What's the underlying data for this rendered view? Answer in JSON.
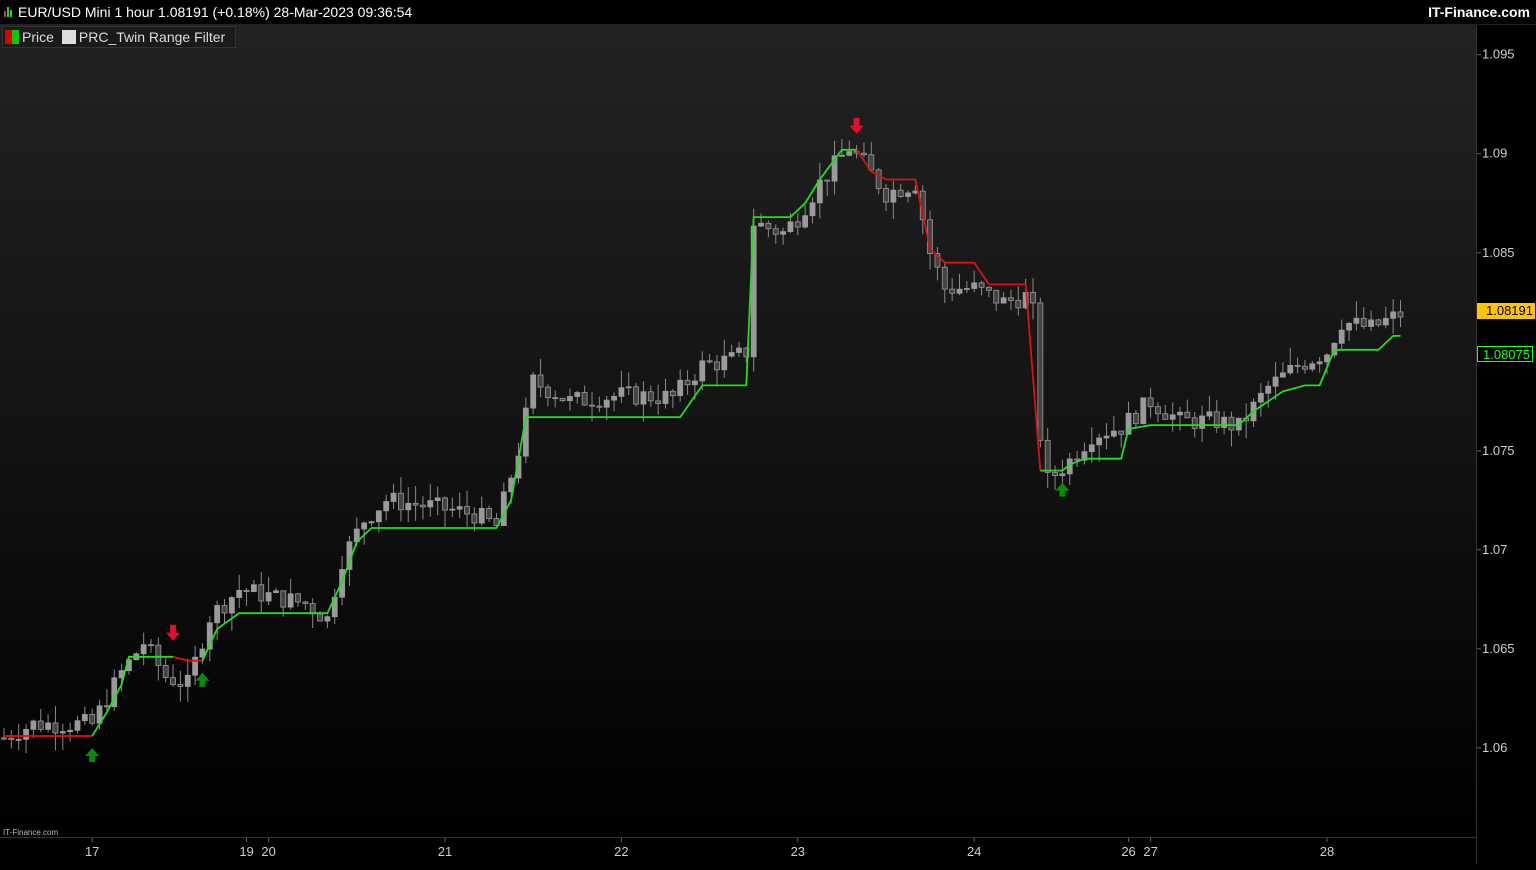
{
  "title_bar": {
    "title": "EUR/USD Mini 1 hour 1.08191 (+0.18%) 28-Mar-2023 09:36:54",
    "brand": "IT-Finance.com"
  },
  "legend": {
    "items": [
      {
        "label": "Price"
      },
      {
        "label": "PRC_Twin Range Filter"
      }
    ]
  },
  "watermark": "IT-Finance.com",
  "price_labels": {
    "last": "1.08191",
    "filter": "1.08075"
  },
  "colors": {
    "up_filter": "#22dd22",
    "down_filter": "#dd1111",
    "last_price_bg": "#ffc400",
    "buy_arrow": "#0a8a0a",
    "sell_arrow": "#e0102f",
    "candle": "#8a8a8a"
  },
  "chart_data": {
    "type": "line",
    "ylim": [
      1.0555,
      1.0965
    ],
    "y_ticks": [
      "1.06",
      "1.065",
      "1.07",
      "1.075",
      "1.08",
      "1.085",
      "1.09",
      "1.095"
    ],
    "x_ticks": [
      "17",
      "19",
      "20",
      "21",
      "22",
      "23",
      "24",
      "26",
      "27",
      "28"
    ],
    "bar_count": 200,
    "x_tick_bars": [
      12,
      33,
      36,
      60,
      84,
      108,
      132,
      153,
      156,
      180
    ],
    "series": [
      {
        "name": "PRC_Twin Range Filter",
        "points": [
          [
            0,
            1.0606
          ],
          [
            12,
            1.0606
          ],
          [
            14,
            1.0618
          ],
          [
            16,
            1.0632
          ],
          [
            17,
            1.0646
          ],
          [
            23,
            1.0646
          ],
          [
            25,
            1.0644
          ],
          [
            27,
            1.0644
          ],
          [
            29,
            1.066
          ],
          [
            32,
            1.0668
          ],
          [
            44,
            1.0668
          ],
          [
            46,
            1.0684
          ],
          [
            48,
            1.0704
          ],
          [
            50,
            1.0711
          ],
          [
            67,
            1.0711
          ],
          [
            69,
            1.0725
          ],
          [
            71,
            1.0767
          ],
          [
            92,
            1.0767
          ],
          [
            95,
            1.0783
          ],
          [
            101,
            1.0783
          ],
          [
            102,
            1.0868
          ],
          [
            107,
            1.0868
          ],
          [
            109,
            1.0875
          ],
          [
            111,
            1.0887
          ],
          [
            114,
            1.0902
          ],
          [
            116,
            1.0902
          ],
          [
            118,
            1.0891
          ],
          [
            120,
            1.0887
          ],
          [
            124,
            1.0887
          ],
          [
            126,
            1.0852
          ],
          [
            128,
            1.0845
          ],
          [
            132,
            1.0845
          ],
          [
            134,
            1.0834
          ],
          [
            139,
            1.0834
          ],
          [
            141,
            1.074
          ],
          [
            144,
            1.074
          ],
          [
            145,
            1.0743
          ],
          [
            147,
            1.0746
          ],
          [
            152,
            1.0746
          ],
          [
            153,
            1.0761
          ],
          [
            156,
            1.0763
          ],
          [
            168,
            1.0763
          ],
          [
            170,
            1.077
          ],
          [
            174,
            1.078
          ],
          [
            177,
            1.0783
          ],
          [
            179,
            1.0783
          ],
          [
            181,
            1.0801
          ],
          [
            187,
            1.0801
          ],
          [
            189,
            1.0808
          ],
          [
            190,
            1.0808
          ]
        ],
        "color_segments": [
          {
            "from": 0,
            "to": 12,
            "color": "down"
          },
          {
            "from": 12,
            "to": 23,
            "color": "up"
          },
          {
            "from": 23,
            "to": 27,
            "color": "down"
          },
          {
            "from": 27,
            "to": 116,
            "color": "up"
          },
          {
            "from": 116,
            "to": 141,
            "color": "down"
          },
          {
            "from": 141,
            "to": 190,
            "color": "up"
          }
        ]
      },
      {
        "name": "Price",
        "type": "candlestick",
        "anchors": [
          [
            0,
            1.0605
          ],
          [
            4,
            1.0612
          ],
          [
            8,
            1.0612
          ],
          [
            12,
            1.0612
          ],
          [
            16,
            1.0638
          ],
          [
            19,
            1.0653
          ],
          [
            22,
            1.0636
          ],
          [
            25,
            1.0632
          ],
          [
            28,
            1.0666
          ],
          [
            32,
            1.068
          ],
          [
            37,
            1.0676
          ],
          [
            41,
            1.0673
          ],
          [
            44,
            1.0665
          ],
          [
            46,
            1.0695
          ],
          [
            49,
            1.0715
          ],
          [
            52,
            1.0725
          ],
          [
            58,
            1.0722
          ],
          [
            64,
            1.0718
          ],
          [
            67,
            1.0712
          ],
          [
            70,
            1.075
          ],
          [
            72,
            1.0785
          ],
          [
            77,
            1.0775
          ],
          [
            84,
            1.0778
          ],
          [
            91,
            1.0777
          ],
          [
            95,
            1.0793
          ],
          [
            99,
            1.0796
          ],
          [
            101,
            1.08
          ],
          [
            102,
            1.0865
          ],
          [
            106,
            1.086
          ],
          [
            108,
            1.0868
          ],
          [
            111,
            1.0885
          ],
          [
            115,
            1.0903
          ],
          [
            117,
            1.0895
          ],
          [
            120,
            1.088
          ],
          [
            124,
            1.0885
          ],
          [
            126,
            1.085
          ],
          [
            128,
            1.0832
          ],
          [
            132,
            1.0832
          ],
          [
            136,
            1.0825
          ],
          [
            139,
            1.0828
          ],
          [
            140,
            1.082
          ],
          [
            141,
            1.0758
          ],
          [
            142,
            1.0735
          ],
          [
            145,
            1.0745
          ],
          [
            148,
            1.0758
          ],
          [
            152,
            1.0762
          ],
          [
            156,
            1.0775
          ],
          [
            160,
            1.0765
          ],
          [
            165,
            1.0765
          ],
          [
            168,
            1.0762
          ],
          [
            172,
            1.0782
          ],
          [
            176,
            1.0793
          ],
          [
            180,
            1.08
          ],
          [
            182,
            1.0815
          ],
          [
            186,
            1.0812
          ],
          [
            190,
            1.0819
          ]
        ]
      }
    ],
    "signals": [
      {
        "type": "buy",
        "bar": 12,
        "price": 1.0606
      },
      {
        "type": "sell",
        "bar": 23,
        "price": 1.0646
      },
      {
        "type": "buy",
        "bar": 27,
        "price": 1.0644
      },
      {
        "type": "sell",
        "bar": 116,
        "price": 1.0902
      },
      {
        "type": "buy",
        "bar": 144,
        "price": 1.074
      }
    ]
  }
}
